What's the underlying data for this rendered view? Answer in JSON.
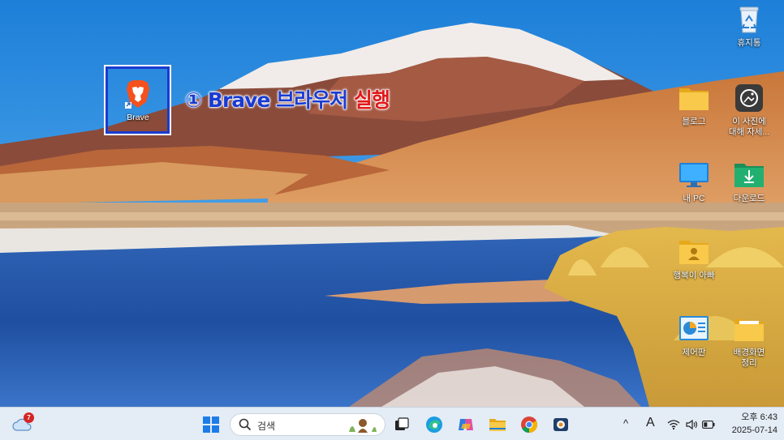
{
  "desktop": {
    "icons": {
      "recycle": {
        "label": "휴지통",
        "icon": "recycle-bin-icon"
      },
      "brave": {
        "label": "Brave",
        "icon": "brave-lion-icon"
      },
      "blog": {
        "label": "블로그",
        "icon": "folder-icon"
      },
      "photo": {
        "label": "이 사진에\n대해 자세...",
        "icon": "photo-info-icon"
      },
      "pc": {
        "label": "내 PC",
        "icon": "monitor-icon"
      },
      "downloads": {
        "label": "다운로드",
        "icon": "download-folder-icon"
      },
      "user": {
        "label": "행복이 아빠",
        "icon": "user-folder-icon"
      },
      "control": {
        "label": "제어판",
        "icon": "control-panel-icon"
      },
      "bg": {
        "label": "배경화면\n정리",
        "icon": "folder-icon"
      }
    },
    "annotation": {
      "num": "①",
      "main": "Brave 브라우저",
      "red": "실행"
    }
  },
  "taskbar": {
    "weather_badge": "7",
    "search_placeholder": "검색",
    "apps": [
      "start-icon",
      "task-view-icon",
      "edge-icon",
      "copilot-icon",
      "file-explorer-icon",
      "chrome-icon",
      "media-app-icon"
    ],
    "tray": {
      "chevron": "^",
      "ime": "A",
      "time_period": "오후 6:43",
      "date": "2025-07-14"
    }
  },
  "colors": {
    "annotation_blue": "#1a3bd0",
    "annotation_red": "#e01818",
    "taskbar_bg": "#e4ecf6",
    "brave_orange": "#f4511e"
  }
}
